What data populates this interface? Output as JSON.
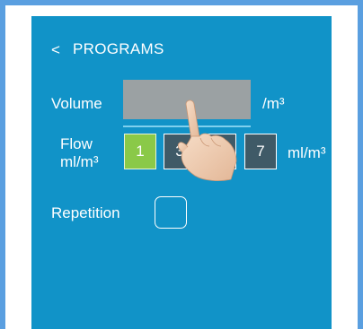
{
  "header": {
    "back_icon": "<",
    "title": "PROGRAMS"
  },
  "volume": {
    "label": "Volume",
    "value": "",
    "unit": "/m³"
  },
  "flow": {
    "label_line1": "Flow",
    "label_line2": "ml/m³",
    "unit": "ml/m³",
    "options": [
      "1",
      "3",
      "5",
      "7"
    ],
    "selected": "1"
  },
  "repetition": {
    "label": "Repetition",
    "checked": false
  },
  "icons": {
    "pointer": "pointing-hand-icon"
  },
  "colors": {
    "screen_bg": "#1193c8",
    "frame": "#5a9fe0",
    "input_bg": "#9ba1a3",
    "button_bg": "#3f5a67",
    "selected_button_bg": "#8ac948"
  }
}
